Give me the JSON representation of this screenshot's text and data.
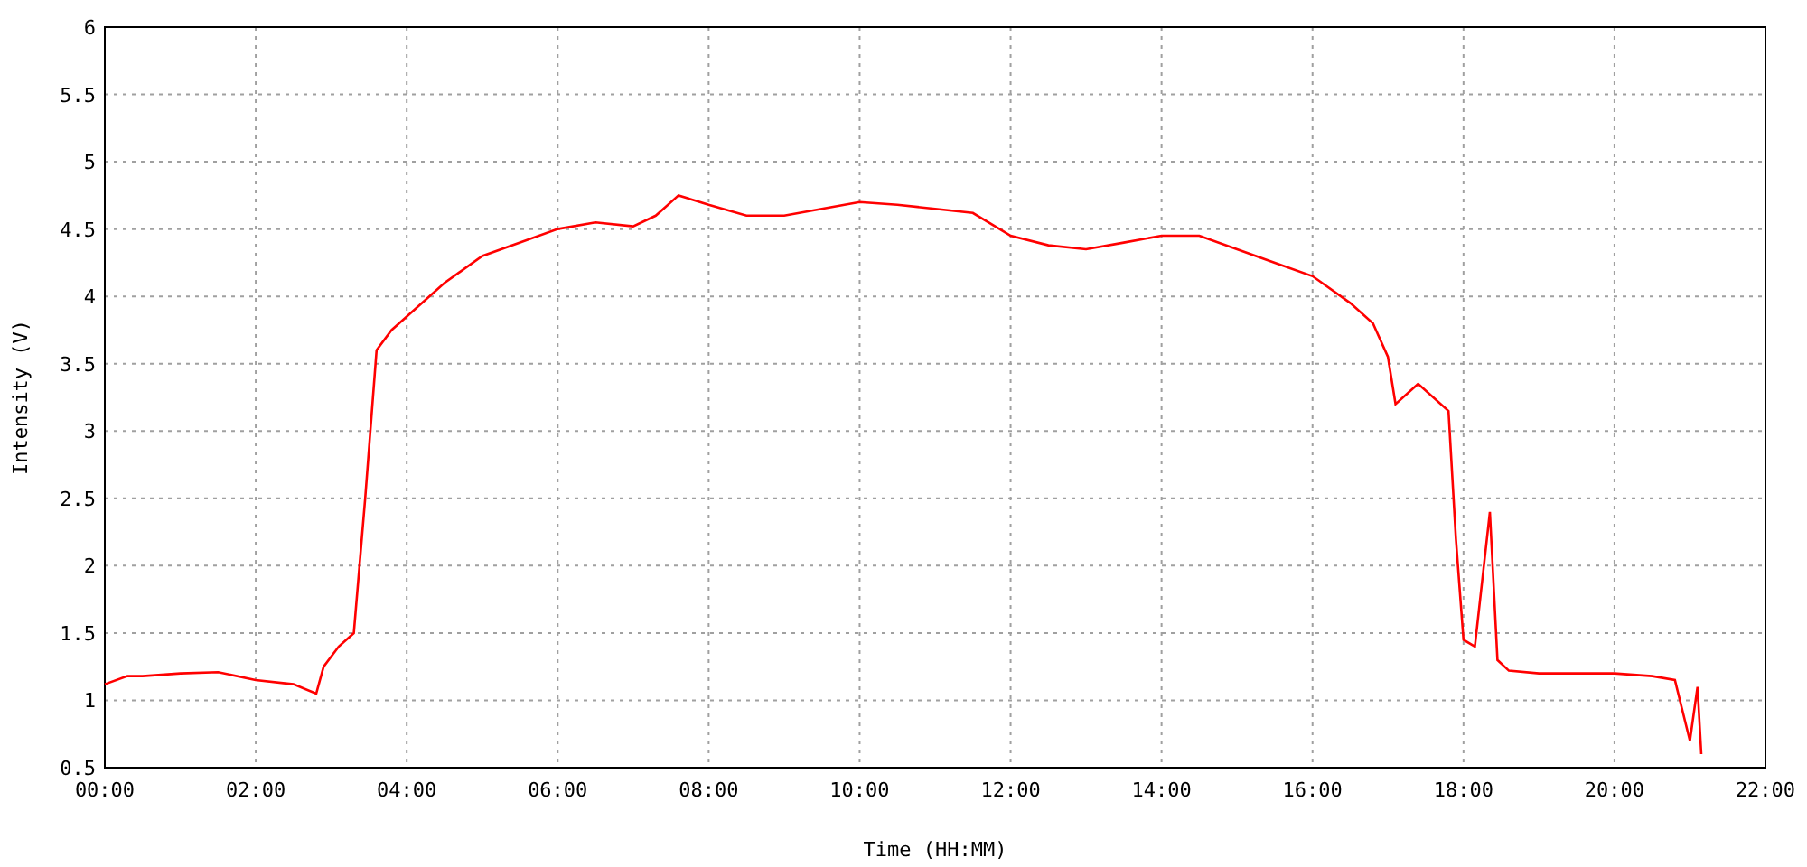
{
  "chart": {
    "chart_data": {
      "type": "line",
      "xlabel": "Time (HH:MM)",
      "ylabel": "Intensity (V)",
      "x": [
        0,
        0.3,
        0.5,
        1,
        1.5,
        2,
        2.5,
        2.8,
        2.9,
        3.1,
        3.3,
        3.45,
        3.6,
        3.8,
        4,
        4.5,
        5,
        5.5,
        6,
        6.5,
        7,
        7.3,
        7.6,
        8,
        8.5,
        9,
        9.5,
        10,
        10.5,
        11,
        11.5,
        12,
        12.5,
        13,
        13.5,
        14,
        14.5,
        15,
        15.5,
        16,
        16.5,
        16.8,
        17,
        17.1,
        17.4,
        17.8,
        17.9,
        18,
        18.15,
        18.35,
        18.45,
        18.6,
        19,
        19.5,
        20,
        20.5,
        20.8,
        21,
        21.1,
        21.15
      ],
      "grid": true,
      "series": [
        {
          "color": "#ff0000",
          "values": [
            1.12,
            1.18,
            1.18,
            1.2,
            1.21,
            1.15,
            1.12,
            1.05,
            1.25,
            1.4,
            1.5,
            2.5,
            3.6,
            3.75,
            3.85,
            4.1,
            4.3,
            4.4,
            4.5,
            4.55,
            4.52,
            4.6,
            4.75,
            4.68,
            4.6,
            4.6,
            4.65,
            4.7,
            4.68,
            4.65,
            4.62,
            4.45,
            4.38,
            4.35,
            4.4,
            4.45,
            4.45,
            4.35,
            4.25,
            4.15,
            3.95,
            3.8,
            3.55,
            3.2,
            3.35,
            3.15,
            2.2,
            1.45,
            1.4,
            2.4,
            1.3,
            1.22,
            1.2,
            1.2,
            1.2,
            1.18,
            1.15,
            0.7,
            1.1,
            0.6
          ]
        }
      ],
      "xlim": [
        0,
        22
      ],
      "ylim": [
        0.5,
        6
      ],
      "xticks": [
        {
          "value": 0,
          "label": "00:00"
        },
        {
          "value": 2,
          "label": "02:00"
        },
        {
          "value": 4,
          "label": "04:00"
        },
        {
          "value": 6,
          "label": "06:00"
        },
        {
          "value": 8,
          "label": "08:00"
        },
        {
          "value": 10,
          "label": "10:00"
        },
        {
          "value": 12,
          "label": "12:00"
        },
        {
          "value": 14,
          "label": "14:00"
        },
        {
          "value": 16,
          "label": "16:00"
        },
        {
          "value": 18,
          "label": "18:00"
        },
        {
          "value": 20,
          "label": "20:00"
        },
        {
          "value": 22,
          "label": "22:00"
        }
      ],
      "yticks": [
        0.5,
        1,
        {
          "value": 1.5,
          "label": "1.5"
        },
        2,
        {
          "value": 2.5,
          "label": "2.5"
        },
        3,
        {
          "value": 3.5,
          "label": "3.5"
        },
        4,
        {
          "value": 4.5,
          "label": "4.5"
        },
        5,
        {
          "value": 5.5,
          "label": "5.5"
        },
        6
      ]
    }
  }
}
